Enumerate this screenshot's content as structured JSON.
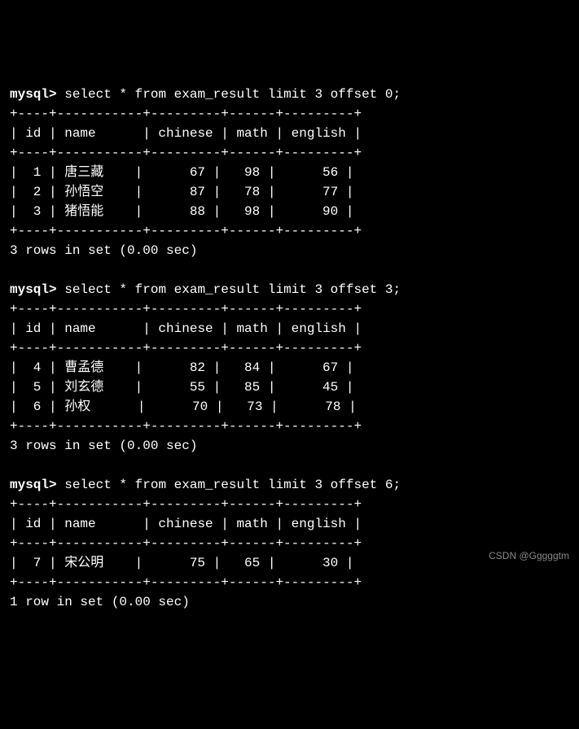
{
  "queries": [
    {
      "prompt": "mysql>",
      "sql": "select * from exam_result limit 3 offset 0;",
      "border": "+----+-----------+---------+------+---------+",
      "header": "| id | name      | chinese | math | english |",
      "rows": [
        "|  1 | 唐三藏    |      67 |   98 |      56 |",
        "|  2 | 孙悟空    |      87 |   78 |      77 |",
        "|  3 | 猪悟能    |      88 |   98 |      90 |"
      ],
      "status": "3 rows in set (0.00 sec)"
    },
    {
      "prompt": "mysql>",
      "sql": "select * from exam_result limit 3 offset 3;",
      "border": "+----+-----------+---------+------+---------+",
      "header": "| id | name      | chinese | math | english |",
      "rows": [
        "|  4 | 曹孟德    |      82 |   84 |      67 |",
        "|  5 | 刘玄德    |      55 |   85 |      45 |",
        "|  6 | 孙权      |      70 |   73 |      78 |"
      ],
      "status": "3 rows in set (0.00 sec)"
    },
    {
      "prompt": "mysql>",
      "sql": "select * from exam_result limit 3 offset 6;",
      "border": "+----+-----------+---------+------+---------+",
      "header": "| id | name      | chinese | math | english |",
      "rows": [
        "|  7 | 宋公明    |      75 |   65 |      30 |"
      ],
      "status": "1 row in set (0.00 sec)"
    }
  ],
  "watermark": "CSDN @Gggggtm",
  "chart_data": {
    "type": "table",
    "title": "exam_result",
    "columns": [
      "id",
      "name",
      "chinese",
      "math",
      "english"
    ],
    "data": [
      {
        "id": 1,
        "name": "唐三藏",
        "chinese": 67,
        "math": 98,
        "english": 56
      },
      {
        "id": 2,
        "name": "孙悟空",
        "chinese": 87,
        "math": 78,
        "english": 77
      },
      {
        "id": 3,
        "name": "猪悟能",
        "chinese": 88,
        "math": 98,
        "english": 90
      },
      {
        "id": 4,
        "name": "曹孟德",
        "chinese": 82,
        "math": 84,
        "english": 67
      },
      {
        "id": 5,
        "name": "刘玄德",
        "chinese": 55,
        "math": 85,
        "english": 45
      },
      {
        "id": 6,
        "name": "孙权",
        "chinese": 70,
        "math": 73,
        "english": 78
      },
      {
        "id": 7,
        "name": "宋公明",
        "chinese": 75,
        "math": 65,
        "english": 30
      }
    ]
  }
}
